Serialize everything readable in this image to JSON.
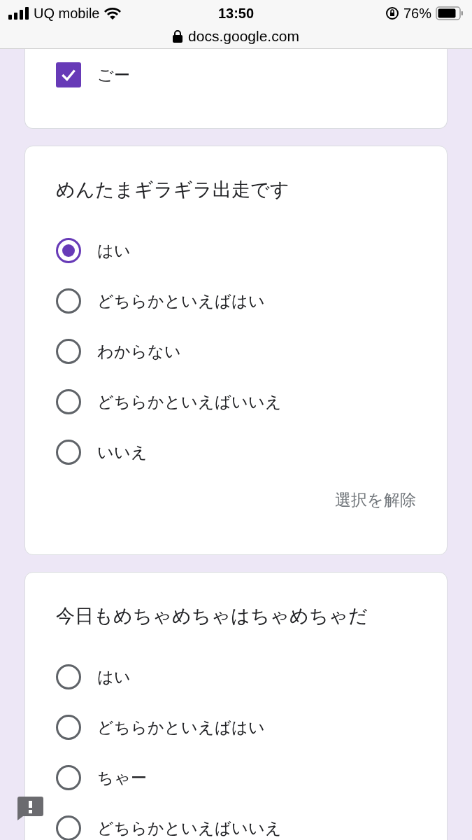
{
  "status_bar": {
    "carrier": "UQ mobile",
    "time": "13:50",
    "battery": "76%",
    "url": "docs.google.com"
  },
  "questions": [
    {
      "kind": "checkbox",
      "options": [
        {
          "label": "ごー",
          "checked": true
        }
      ]
    },
    {
      "kind": "radio",
      "title": "めんたまギラギラ出走です",
      "options": [
        {
          "label": "はい",
          "selected": true
        },
        {
          "label": "どちらかといえばはい",
          "selected": false
        },
        {
          "label": "わからない",
          "selected": false
        },
        {
          "label": "どちらかといえばいいえ",
          "selected": false
        },
        {
          "label": "いいえ",
          "selected": false
        }
      ],
      "clear_label": "選択を解除"
    },
    {
      "kind": "radio",
      "title": "今日もめちゃめちゃはちゃめちゃだ",
      "options": [
        {
          "label": "はい",
          "selected": false
        },
        {
          "label": "どちらかといえばはい",
          "selected": false
        },
        {
          "label": "ちゃー",
          "selected": false
        },
        {
          "label": "どちらかといえばいいえ",
          "selected": false
        }
      ]
    }
  ]
}
